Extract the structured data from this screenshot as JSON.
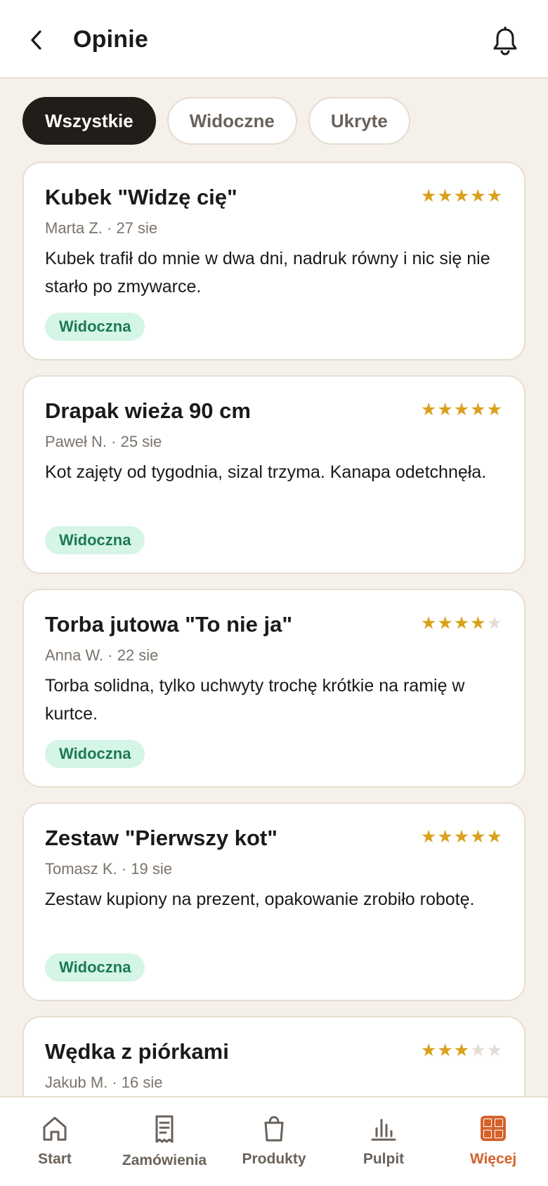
{
  "header": {
    "title": "Opinie",
    "back_icon": "chevron-left-icon",
    "notifications_icon": "bell-icon"
  },
  "filters": [
    {
      "label": "Wszystkie",
      "active": true
    },
    {
      "label": "Widoczne",
      "active": false
    },
    {
      "label": "Ukryte",
      "active": false
    }
  ],
  "reviews": [
    {
      "product": "Kubek \"Widzę cię\"",
      "rating": 5,
      "meta": "Marta Z. · 27 sie",
      "text": "Kubek trafił do mnie w dwa dni, nadruk równy i nic się nie starło po zmywarce.",
      "status": "Widoczna"
    },
    {
      "product": "Drapak wieża 90 cm",
      "rating": 5,
      "meta": "Paweł N. · 25 sie",
      "text": "Kot zajęty od tygodnia, sizal trzyma. Kanapa odetchnęła.",
      "status": "Widoczna"
    },
    {
      "product": "Torba jutowa \"To nie ja\"",
      "rating": 4,
      "meta": "Anna W. · 22 sie",
      "text": "Torba solidna, tylko uchwyty trochę krótkie na ramię w kurtce.",
      "status": "Widoczna"
    },
    {
      "product": "Zestaw \"Pierwszy kot\"",
      "rating": 5,
      "meta": "Tomasz K. · 19 sie",
      "text": "Zestaw kupiony na prezent, opakowanie zrobiło robotę.",
      "status": "Widoczna"
    },
    {
      "product": "Wędka z piórkami",
      "rating": 3,
      "meta": "Jakub M. · 16 sie",
      "text": "",
      "status": ""
    }
  ],
  "bottom_nav": [
    {
      "label": "Start",
      "icon": "home-icon",
      "active": false
    },
    {
      "label": "Zamówienia",
      "icon": "receipt-icon",
      "active": false
    },
    {
      "label": "Produkty",
      "icon": "shopping-bag-icon",
      "active": false
    },
    {
      "label": "Pulpit",
      "icon": "bar-chart-icon",
      "active": false
    },
    {
      "label": "Więcej",
      "icon": "grid-icon",
      "active": true
    }
  ],
  "colors": {
    "background": "#f5f1ea",
    "accent": "#d4622a",
    "star": "#d9a21b",
    "badge_bg": "#d5f5e6",
    "badge_text": "#1c7a55",
    "chip_active": "#231d19"
  }
}
